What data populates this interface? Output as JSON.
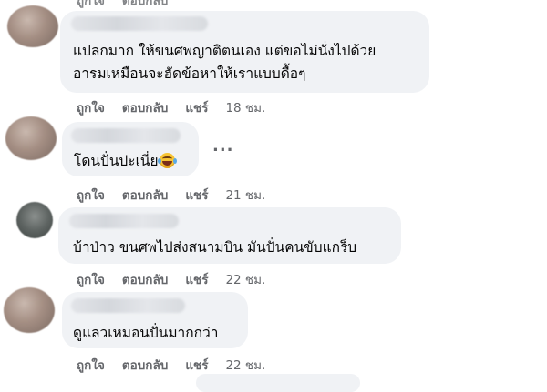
{
  "actions": {
    "like": "ถูกใจ",
    "reply": "ตอบกลับ",
    "share": "แชร์"
  },
  "comments": [
    {
      "text_line1": "แปลกมาก ให้ขนศพญาติตนเอง แต่ขอไม่นั่งไปด้วย",
      "text_line2": "อารมเหมือนจะฮัดข้อหาให้เราแบบดื้อๆ",
      "time": "18 ชม."
    },
    {
      "text": "โดนปั่นปะเนี่ย",
      "emoji": "face-with-tears-of-joy",
      "more": "...",
      "time": "21 ชม."
    },
    {
      "text": "บ้าป่าว ขนศพไปส่งสนามบิน มันปั่นคนขับแกร็บ",
      "time": "22 ชม."
    },
    {
      "text": "ดูแลวเหมอนปั่นมากกว่า",
      "time": "22 ชม."
    }
  ]
}
